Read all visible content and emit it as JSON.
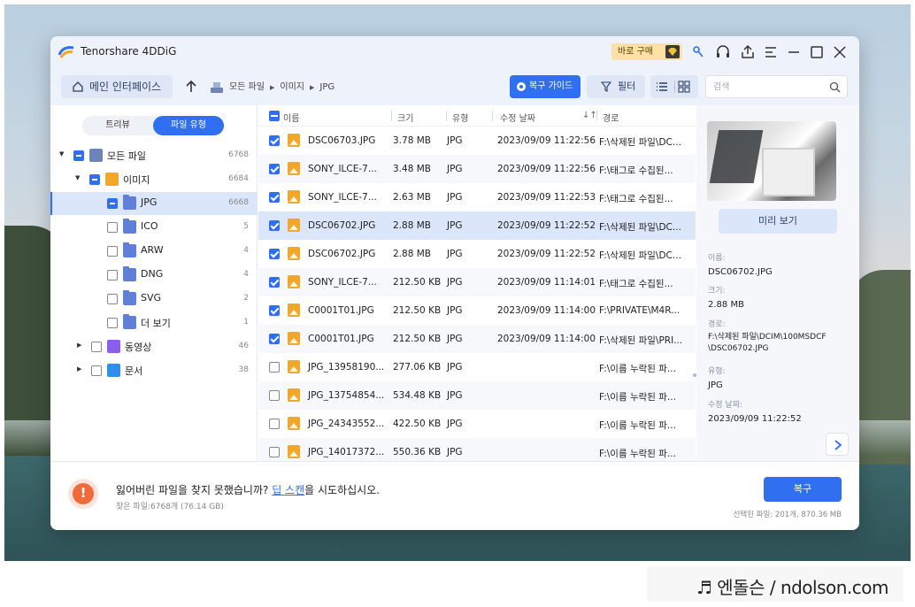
{
  "app": {
    "title": "Tenorshare 4DDiG",
    "buy_label": "바로 구매"
  },
  "toolbar": {
    "home_label": "메인 인터페이스",
    "breadcrumb": [
      "모든 파일",
      "이미지",
      "JPG"
    ],
    "recover_guide_label": "복구 가이드",
    "filter_label": "필터",
    "search_placeholder": "검색"
  },
  "left": {
    "tab_tree": "트리뷰",
    "tab_type": "파일 유형",
    "tree": [
      {
        "label": "모든 파일",
        "count": "6768"
      },
      {
        "label": "이미지",
        "count": "6684"
      },
      {
        "label": "JPG",
        "count": "6668"
      },
      {
        "label": "ICO",
        "count": "5"
      },
      {
        "label": "ARW",
        "count": "4"
      },
      {
        "label": "DNG",
        "count": "4"
      },
      {
        "label": "SVG",
        "count": "2"
      },
      {
        "label": "더 보기",
        "count": "1"
      },
      {
        "label": "동영상",
        "count": "46"
      },
      {
        "label": "문서",
        "count": "38"
      }
    ]
  },
  "list": {
    "headers": {
      "name": "이름",
      "size": "크기",
      "type": "유형",
      "date": "수정 날짜",
      "path": "경로"
    },
    "rows": [
      {
        "name": "DSC06703.JPG",
        "size": "3.78 MB",
        "type": "JPG",
        "date": "2023/09/09 11:22:56",
        "path": "F:\\삭제된 파일\\DC..."
      },
      {
        "name": "SONY_ILCE-7...",
        "size": "3.48 MB",
        "type": "JPG",
        "date": "2023/09/09 11:22:56",
        "path": "F:\\태그로 수집된..."
      },
      {
        "name": "SONY_ILCE-7...",
        "size": "2.63 MB",
        "type": "JPG",
        "date": "2023/09/09 11:22:53",
        "path": "F:\\태그로 수집된..."
      },
      {
        "name": "DSC06702.JPG",
        "size": "2.88 MB",
        "type": "JPG",
        "date": "2023/09/09 11:22:52",
        "path": "F:\\삭제된 파일\\DC..."
      },
      {
        "name": "DSC06702.JPG",
        "size": "2.88 MB",
        "type": "JPG",
        "date": "2023/09/09 11:22:52",
        "path": "F:\\삭제된 파일\\DC..."
      },
      {
        "name": "SONY_ILCE-7...",
        "size": "212.50 KB",
        "type": "JPG",
        "date": "2023/09/09 11:14:01",
        "path": "F:\\태그로 수집된..."
      },
      {
        "name": "C0001T01.JPG",
        "size": "212.50 KB",
        "type": "JPG",
        "date": "2023/09/09 11:14:00",
        "path": "F:\\PRIVATE\\M4R..."
      },
      {
        "name": "C0001T01.JPG",
        "size": "212.50 KB",
        "type": "JPG",
        "date": "2023/09/09 11:14:00",
        "path": "F:\\삭제된 파일\\PRI..."
      },
      {
        "name": "JPG_13958190...",
        "size": "277.06 KB",
        "type": "JPG",
        "date": "",
        "path": "F:\\이름 누락된 파..."
      },
      {
        "name": "JPG_13754854...",
        "size": "534.48 KB",
        "type": "JPG",
        "date": "",
        "path": "F:\\이름 누락된 파..."
      },
      {
        "name": "JPG_24343552...",
        "size": "422.50 KB",
        "type": "JPG",
        "date": "",
        "path": "F:\\이름 누락된 파..."
      },
      {
        "name": "JPG_14017372...",
        "size": "550.36 KB",
        "type": "JPG",
        "date": "",
        "path": "F:\\이름 누락된 파..."
      }
    ]
  },
  "preview": {
    "button_label": "미리 보기",
    "name_key": "이름:",
    "name_value": "DSC06702.JPG",
    "size_key": "크기:",
    "size_value": "2.88 MB",
    "path_key": "경로:",
    "path_value_1": "F:\\삭제된 파일\\DCIM\\100MSDCF",
    "path_value_2": "\\DSC06702.JPG",
    "type_key": "유형:",
    "type_value": "JPG",
    "date_key": "수정 날짜:",
    "date_value": "2023/09/09 11:22:52"
  },
  "footer": {
    "message_prefix": "잃어버린 파일을 찾지 못했습니까? ",
    "message_link": "딥 스캔",
    "message_suffix": "을 시도하십시오.",
    "found_text": "찾은 파일:6768개 (76.14 GB)",
    "recover_label": "복구",
    "selected_text": "선택된 파일: 201개, 870.36 MB"
  },
  "watermark": {
    "text": "♬ 엔돌슨 / ndolson.com"
  }
}
